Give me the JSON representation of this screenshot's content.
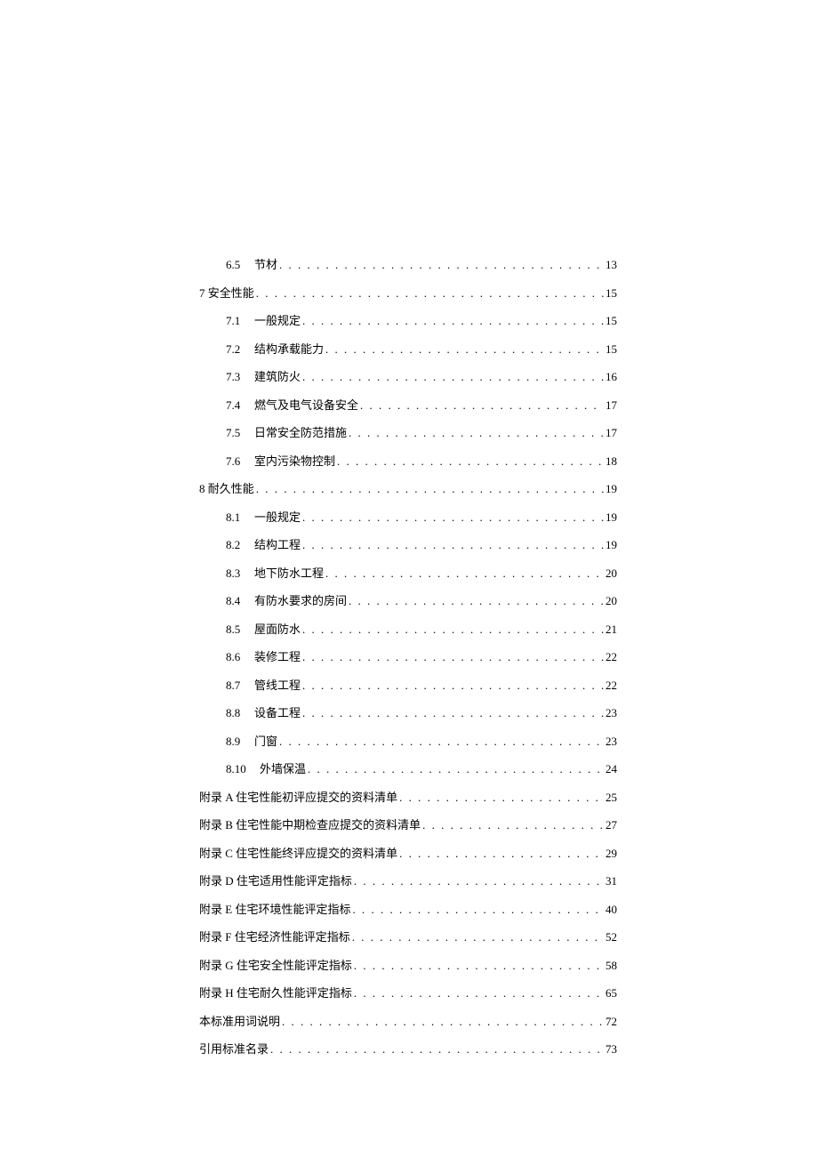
{
  "toc": [
    {
      "type": "sub",
      "number": "6.5",
      "title": "节材",
      "page": "13"
    },
    {
      "type": "main",
      "number": "7",
      "title": "安全性能",
      "page": "15"
    },
    {
      "type": "sub",
      "number": "7.1",
      "title": "一般规定",
      "page": "15"
    },
    {
      "type": "sub",
      "number": "7.2",
      "title": "结构承载能力",
      "page": "15"
    },
    {
      "type": "sub",
      "number": "7.3",
      "title": "建筑防火",
      "page": "16"
    },
    {
      "type": "sub",
      "number": "7.4",
      "title": "燃气及电气设备安全",
      "page": "17"
    },
    {
      "type": "sub",
      "number": "7.5",
      "title": "日常安全防范措施",
      "page": "17"
    },
    {
      "type": "sub",
      "number": "7.6",
      "title": "室内污染物控制",
      "page": "18"
    },
    {
      "type": "main",
      "number": "8",
      "title": "耐久性能",
      "page": "19"
    },
    {
      "type": "sub",
      "number": "8.1",
      "title": "一般规定",
      "page": "19"
    },
    {
      "type": "sub",
      "number": "8.2",
      "title": "结构工程",
      "page": "19"
    },
    {
      "type": "sub",
      "number": "8.3",
      "title": "地下防水工程",
      "page": "20"
    },
    {
      "type": "sub",
      "number": "8.4",
      "title": "有防水要求的房间",
      "page": "20"
    },
    {
      "type": "sub",
      "number": "8.5",
      "title": "屋面防水",
      "page": "21"
    },
    {
      "type": "sub",
      "number": "8.6",
      "title": "装修工程",
      "page": "22"
    },
    {
      "type": "sub",
      "number": "8.7",
      "title": "管线工程",
      "page": "22"
    },
    {
      "type": "sub",
      "number": "8.8",
      "title": "设备工程",
      "page": "23"
    },
    {
      "type": "sub",
      "number": "8.9",
      "title": "门窗",
      "page": "23"
    },
    {
      "type": "sub",
      "number": "8.10",
      "title": "外墙保温",
      "page": "24",
      "wide": true
    },
    {
      "type": "appendix",
      "title": "附录 A 住宅性能初评应提交的资料清单",
      "page": "25",
      "space": true
    },
    {
      "type": "appendix",
      "title": "附录 B 住宅性能中期检查应提交的资料清单",
      "page": "27",
      "space": true
    },
    {
      "type": "appendix",
      "title": "附录 C 住宅性能终评应提交的资料清单",
      "page": "29",
      "space": true
    },
    {
      "type": "appendix",
      "title": "附录 D 住宅适用性能评定指标",
      "page": "31",
      "space": true
    },
    {
      "type": "appendix",
      "title": "附录 E 住宅环境性能评定指标",
      "page": "40"
    },
    {
      "type": "appendix",
      "title": "附录 F 住宅经济性能评定指标",
      "page": "52"
    },
    {
      "type": "appendix",
      "title": "附录 G 住宅安全性能评定指标",
      "page": "58",
      "space": true
    },
    {
      "type": "appendix",
      "title": "附录 H 住宅耐久性能评定指标",
      "page": "65",
      "space": true
    },
    {
      "type": "appendix",
      "title": "本标准用词说明",
      "page": "72"
    },
    {
      "type": "appendix",
      "title": "引用标准名录",
      "page": "73"
    }
  ],
  "dots": ". . . . . . . . . . . . . . . . . . . . . . . . . . . . . . . . . . . . . . . . . . . . . . . . . . . . . . . . . . . . . . . . . . . . . . . . . . . . . . . . . . . . . . . . . . . . . . . . . . . ."
}
